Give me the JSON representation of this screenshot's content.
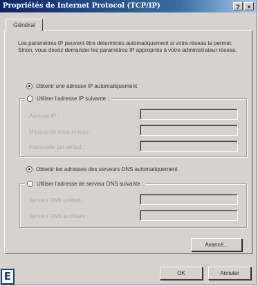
{
  "window": {
    "title": "Propriétés de Internet Protocol (TCP/IP)",
    "help_button": "?",
    "close_button": "×"
  },
  "tabs": [
    {
      "label": "Général"
    }
  ],
  "description": "Les paramètres IP peuvent être déterminés automatiquement si votre réseau le permet. Sinon, vous devez demander les paramètres IP appropriés à votre administrateur réseau.",
  "ip": {
    "auto_label": "Obtenir une adresse IP automatiquement",
    "auto_selected": true,
    "manual_label": "Utiliser l'adresse IP suivante :",
    "manual_selected": false,
    "fields": [
      {
        "label": "Adresse IP :",
        "value": ""
      },
      {
        "label": "Masque de sous-réseau :",
        "value": ""
      },
      {
        "label": "Passerelle par défaut :",
        "value": ""
      }
    ]
  },
  "dns": {
    "auto_label": "Obtenir les adresses des serveurs DNS automatiquement",
    "auto_selected": true,
    "manual_label": "Utiliser l'adresse de serveur DNS suivante :",
    "manual_selected": false,
    "fields": [
      {
        "label": "Serveur DNS préféré :",
        "value": ""
      },
      {
        "label": "Serveur DNS auxiliaire :",
        "value": ""
      }
    ]
  },
  "buttons": {
    "advanced": "Avancé...",
    "ok": "OK",
    "cancel": "Annuler"
  },
  "corner_letter": "E"
}
